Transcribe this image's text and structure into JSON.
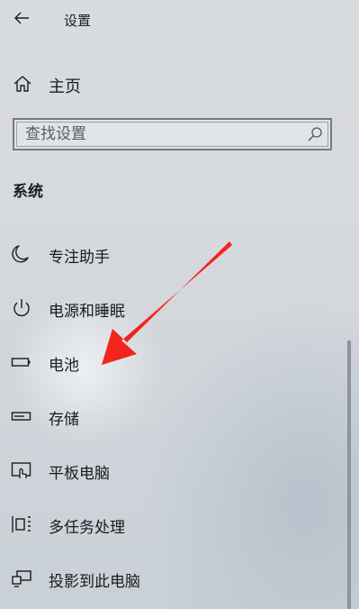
{
  "window": {
    "title": "设置"
  },
  "home": {
    "label": "主页",
    "icon": "home-icon"
  },
  "search": {
    "placeholder": "查找设置",
    "icon": "search-icon"
  },
  "section": {
    "title": "系统"
  },
  "nav": {
    "items": [
      {
        "label": "专注助手",
        "icon": "moon-icon"
      },
      {
        "label": "电源和睡眠",
        "icon": "power-icon"
      },
      {
        "label": "电池",
        "icon": "battery-icon"
      },
      {
        "label": "存储",
        "icon": "storage-icon"
      },
      {
        "label": "平板电脑",
        "icon": "tablet-icon"
      },
      {
        "label": "多任务处理",
        "icon": "multitasking-icon"
      },
      {
        "label": "投影到此电脑",
        "icon": "project-icon"
      }
    ]
  },
  "annotation": {
    "arrow_color": "#f2251b"
  }
}
